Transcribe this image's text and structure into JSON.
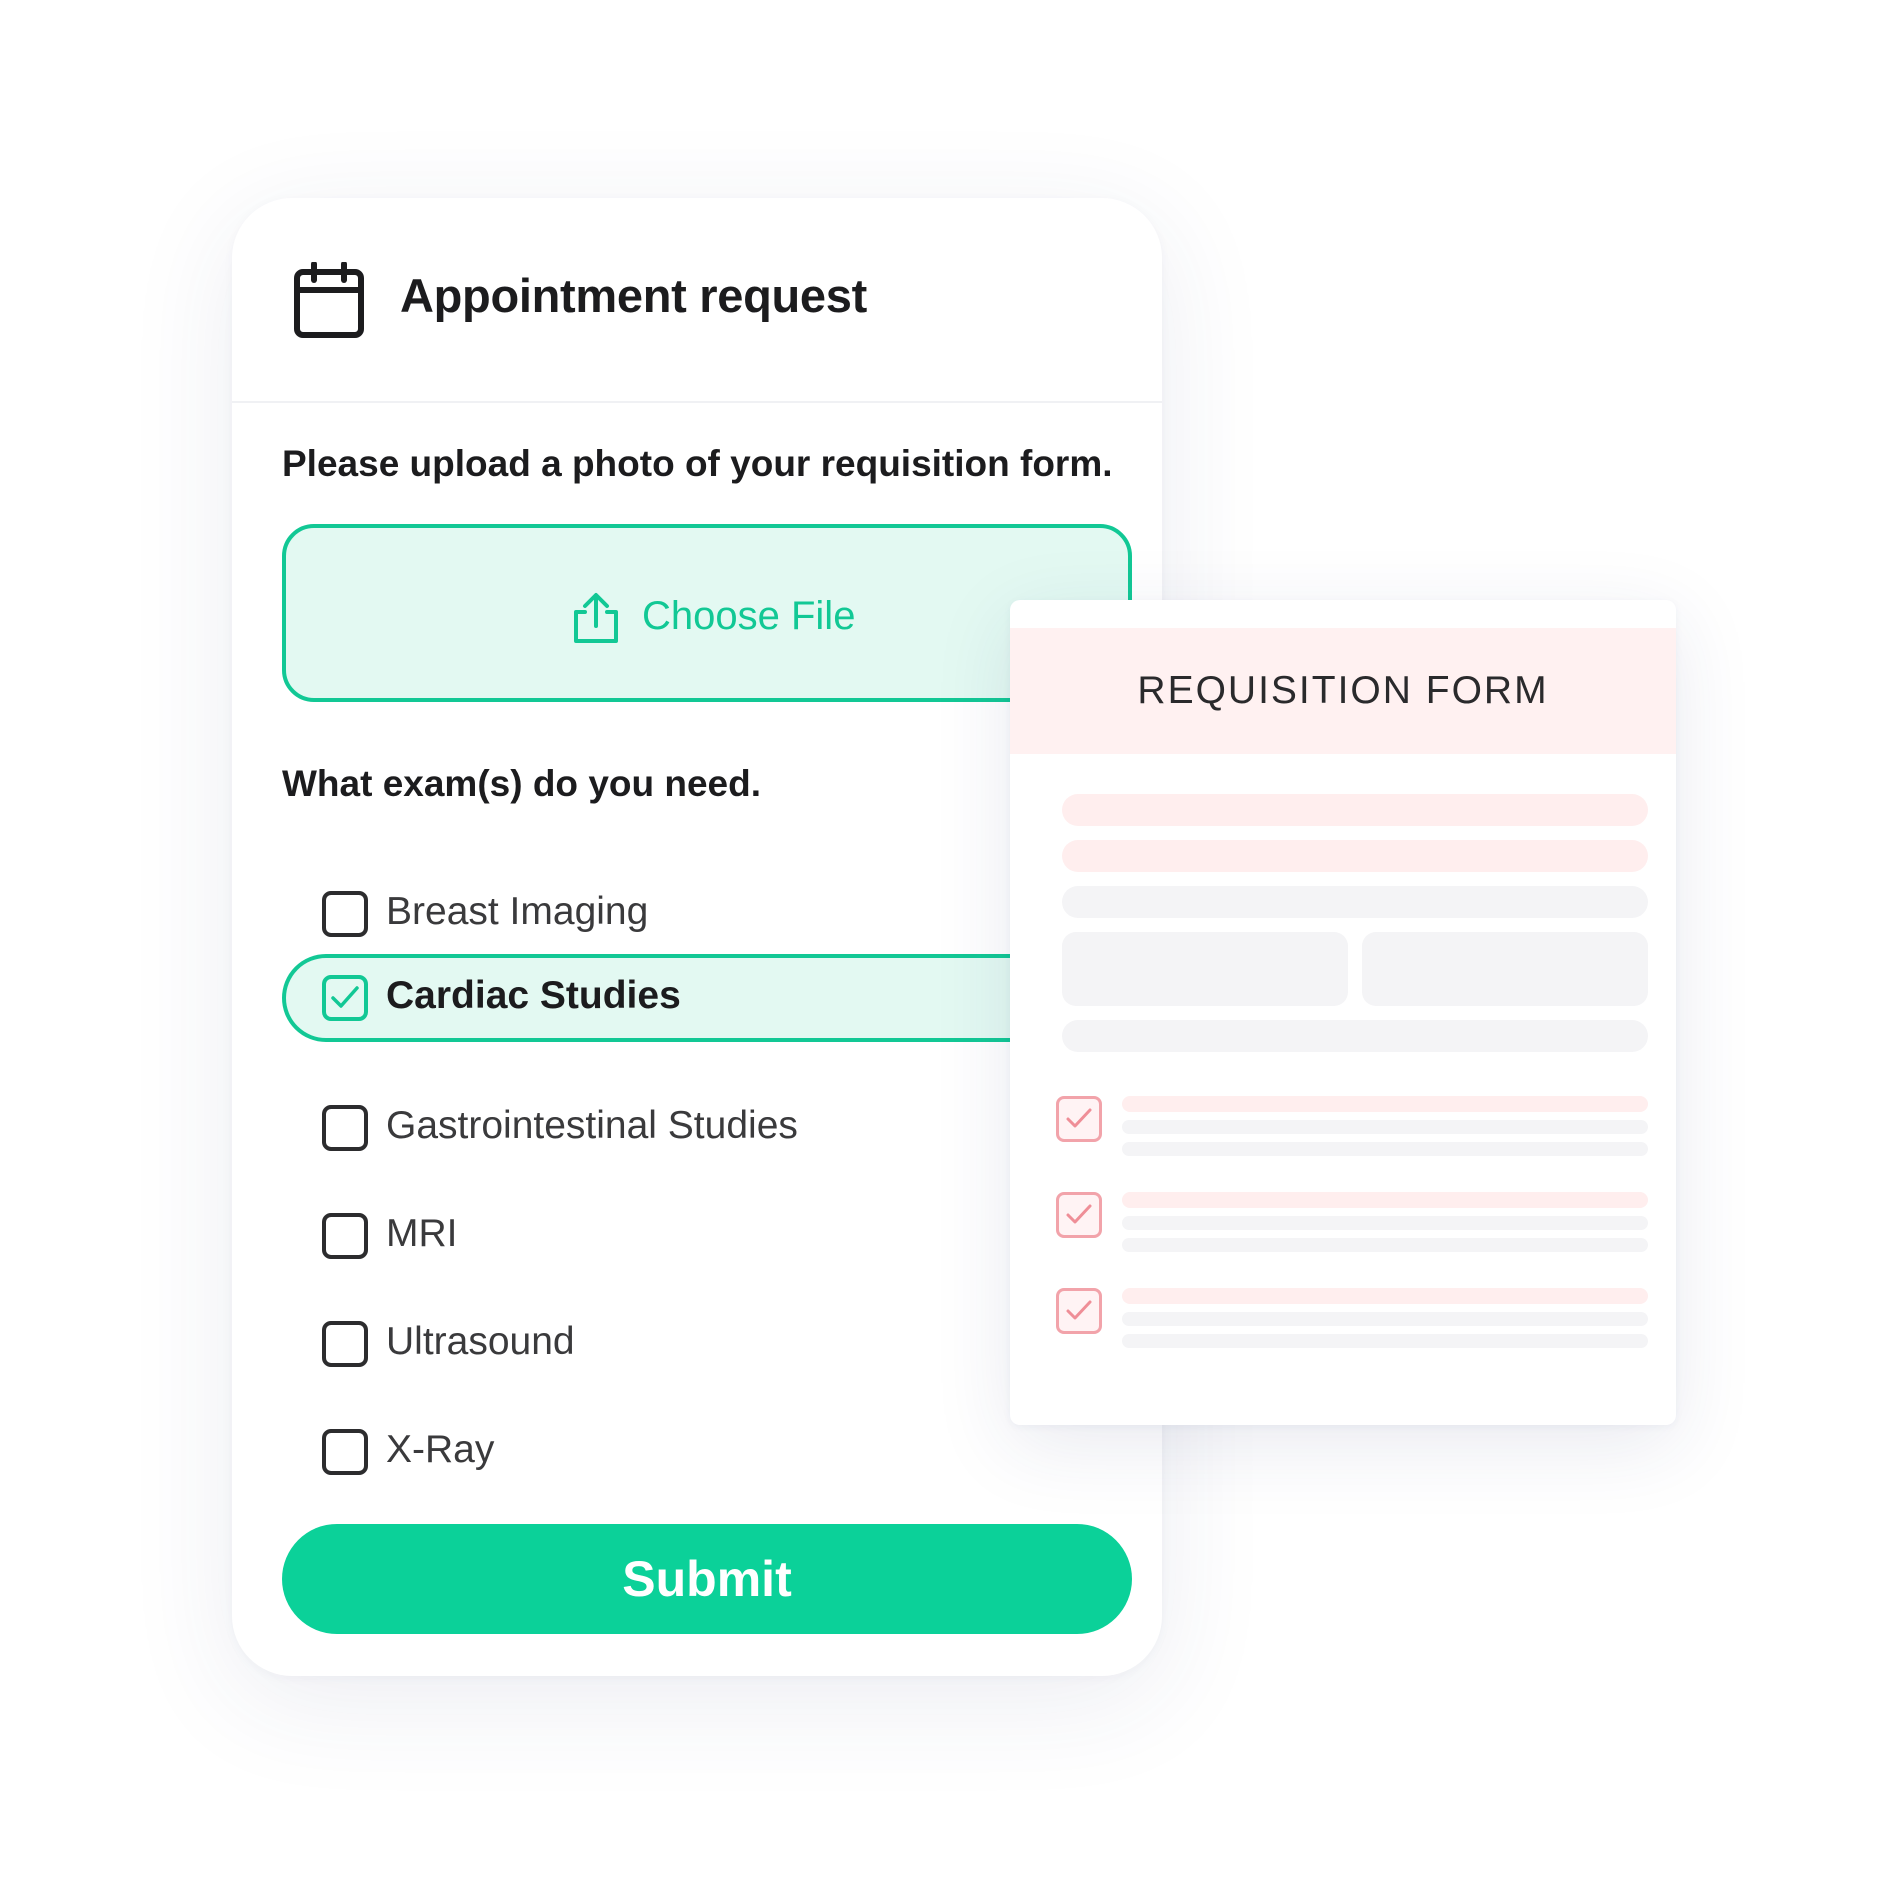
{
  "header": {
    "title": "Appointment request",
    "icon": "calendar-icon"
  },
  "upload": {
    "prompt": "Please upload a photo of your requisition form.",
    "button_label": "Choose File",
    "icon": "upload-icon"
  },
  "exams": {
    "question": "What exam(s) do you need.",
    "options": [
      {
        "label": "Breast Imaging",
        "checked": false
      },
      {
        "label": "Cardiac Studies",
        "checked": true
      },
      {
        "label": "Gastrointestinal Studies",
        "checked": false
      },
      {
        "label": "MRI",
        "checked": false
      },
      {
        "label": "Ultrasound",
        "checked": false
      },
      {
        "label": "X-Ray",
        "checked": false
      }
    ]
  },
  "submit": {
    "label": "Submit"
  },
  "requisition": {
    "title": "REQUISITION FORM",
    "checked_items": 3
  },
  "colors": {
    "accent": "#12c895",
    "accent_light": "#e3f9f2",
    "submit": "#0bd199",
    "doc_header": "#fff1f1",
    "doc_check": "#f2a3aa"
  }
}
